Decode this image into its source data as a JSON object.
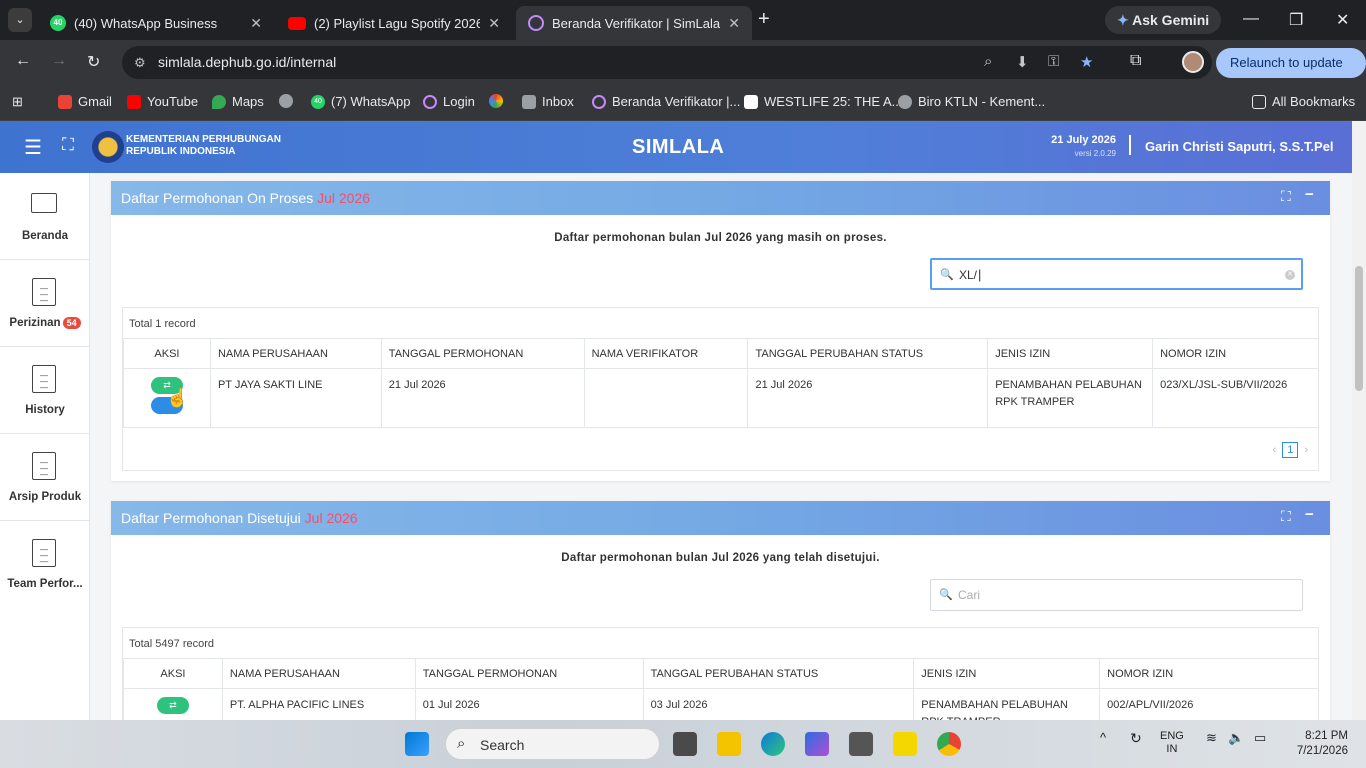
{
  "browser": {
    "tabs": [
      {
        "title": "(40) WhatsApp Business",
        "badge": "40",
        "active": false
      },
      {
        "title": "(2) Playlist Lagu Spotify 2026 Te",
        "active": false
      },
      {
        "title": "Beranda Verifikator | SimLala",
        "active": true
      }
    ],
    "ask_gemini": "Ask Gemini",
    "url": "simlala.dephub.go.id/internal",
    "relaunch_label": "Relaunch to update",
    "bookmarks": [
      {
        "label": "Gmail"
      },
      {
        "label": "YouTube"
      },
      {
        "label": "Maps"
      },
      {
        "label": ""
      },
      {
        "label": "(7) WhatsApp",
        "badge": "40"
      },
      {
        "label": "Login"
      },
      {
        "label": ""
      },
      {
        "label": "Inbox"
      },
      {
        "label": "Beranda Verifikator |..."
      },
      {
        "label": "WESTLIFE 25: THE A..."
      },
      {
        "label": "Biro KTLN - Kement..."
      }
    ],
    "all_bookmarks": "All Bookmarks"
  },
  "header": {
    "org_line1": "KEMENTERIAN PERHUBUNGAN",
    "org_line2": "REPUBLIK INDONESIA",
    "app_title": "SIMLALA",
    "date": "21 July 2026",
    "version": "versi 2.0.29",
    "user": "Garin Christi Saputri, S.S.T.Pel"
  },
  "sidebar": {
    "items": [
      {
        "label": "Beranda",
        "icon": "monitor-icon"
      },
      {
        "label": "Perizinan",
        "badge": "54",
        "icon": "document-icon"
      },
      {
        "label": "History",
        "icon": "document-icon"
      },
      {
        "label": "Arsip Produk",
        "icon": "document-icon"
      },
      {
        "label": "Team Perfor...",
        "icon": "document-icon"
      }
    ]
  },
  "panel_proses": {
    "title": "Daftar Permohonan On Proses",
    "month": "Jul 2026",
    "subtitle": "Daftar permohonan bulan Jul 2026 yang masih on proses.",
    "search_value": "XL/",
    "total": "Total 1 record",
    "columns": [
      "AKSI",
      "NAMA PERUSAHAAN",
      "TANGGAL PERMOHONAN",
      "NAMA VERIFIKATOR",
      "TANGGAL PERUBAHAN STATUS",
      "JENIS IZIN",
      "NOMOR IZIN"
    ],
    "rows": [
      {
        "nama": "PT JAYA SAKTI LINE",
        "tgl_permohonan": "21 Jul 2026",
        "verifikator": "",
        "tgl_status": "21 Jul 2026",
        "jenis_izin": "PENAMBAHAN PELABUHAN RPK TRAMPER",
        "nomor_izin": "023/XL/JSL-SUB/VII/2026"
      }
    ],
    "page": "1"
  },
  "panel_disetujui": {
    "title": "Daftar Permohonan Disetujui",
    "month": "Jul 2026",
    "subtitle": "Daftar permohonan bulan Jul 2026 yang telah disetujui.",
    "search_placeholder": "Cari",
    "total": "Total 5497 record",
    "columns": [
      "AKSI",
      "NAMA PERUSAHAAN",
      "TANGGAL PERMOHONAN",
      "TANGGAL PERUBAHAN STATUS",
      "JENIS IZIN",
      "NOMOR IZIN"
    ],
    "rows": [
      {
        "nama": "PT. ALPHA PACIFIC LINES",
        "tgl_permohonan": "01 Jul 2026",
        "tgl_status": "03 Jul 2026",
        "jenis_izin": "PENAMBAHAN PELABUHAN RPK TRAMPER",
        "nomor_izin": "002/APL/VII/2026"
      }
    ]
  },
  "taskbar": {
    "search_label": "Search",
    "lang_line1": "ENG",
    "lang_line2": "IN",
    "time": "8:21 PM",
    "date": "7/21/2026"
  },
  "colors": {
    "header_blue": "#3f73d0",
    "accent_red": "#ff4a6a",
    "action_green": "#2ec27e",
    "action_blue": "#2d8ce6"
  }
}
